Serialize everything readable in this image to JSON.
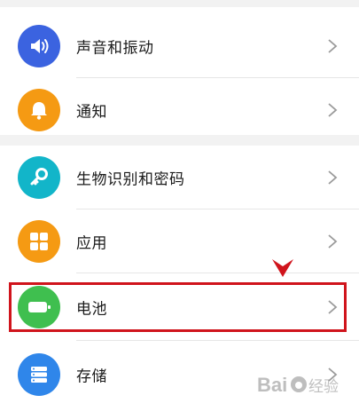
{
  "settings": {
    "items": [
      {
        "id": "sound",
        "label": "声音和振动",
        "icon": "speaker-icon",
        "color": "#3b63e0"
      },
      {
        "id": "notify",
        "label": "通知",
        "icon": "bell-icon",
        "color": "#f59a13"
      },
      {
        "id": "biometric",
        "label": "生物识别和密码",
        "icon": "key-icon",
        "color": "#12b5c9"
      },
      {
        "id": "apps",
        "label": "应用",
        "icon": "grid-icon",
        "color": "#f59a13"
      },
      {
        "id": "battery",
        "label": "电池",
        "icon": "battery-icon",
        "color": "#3fbf4f"
      },
      {
        "id": "storage",
        "label": "存储",
        "icon": "storage-icon",
        "color": "#2f86ea"
      }
    ]
  },
  "annotation": {
    "highlight_color": "#d0141c"
  },
  "watermark": {
    "brand": "Bai",
    "suffix": "经验"
  }
}
